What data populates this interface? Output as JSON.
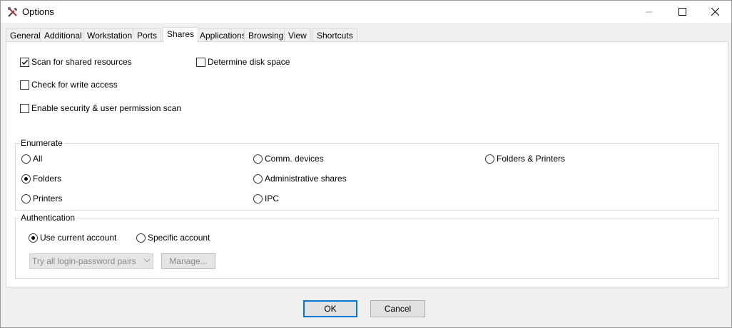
{
  "window": {
    "title": "Options",
    "app_icon": "tools-icon"
  },
  "tabs": [
    "General",
    "Additional",
    "Workstation",
    "Ports",
    "Shares",
    "Applications",
    "Browsing",
    "View",
    "Shortcuts"
  ],
  "active_tab": "Shares",
  "checkboxes": {
    "scan_shared": {
      "label": "Scan for shared resources",
      "checked": true
    },
    "disk_space": {
      "label": "Determine disk space",
      "checked": false
    },
    "write_access": {
      "label": "Check for write access",
      "checked": false
    },
    "security_scan": {
      "label": "Enable security & user permission scan",
      "checked": false
    }
  },
  "enumerate": {
    "label": "Enumerate",
    "options": {
      "all": "All",
      "folders": "Folders",
      "printers": "Printers",
      "comm_devices": "Comm. devices",
      "admin_shares": "Administrative shares",
      "ipc": "IPC",
      "folders_printers": "Folders & Printers"
    },
    "selected": "Folders"
  },
  "authentication": {
    "label": "Authentication",
    "use_current": "Use current account",
    "specific": "Specific account",
    "selected": "Use current account",
    "login_select": "Try all login-password pairs",
    "manage_button": "Manage..."
  },
  "buttons": {
    "ok": "OK",
    "cancel": "Cancel"
  }
}
